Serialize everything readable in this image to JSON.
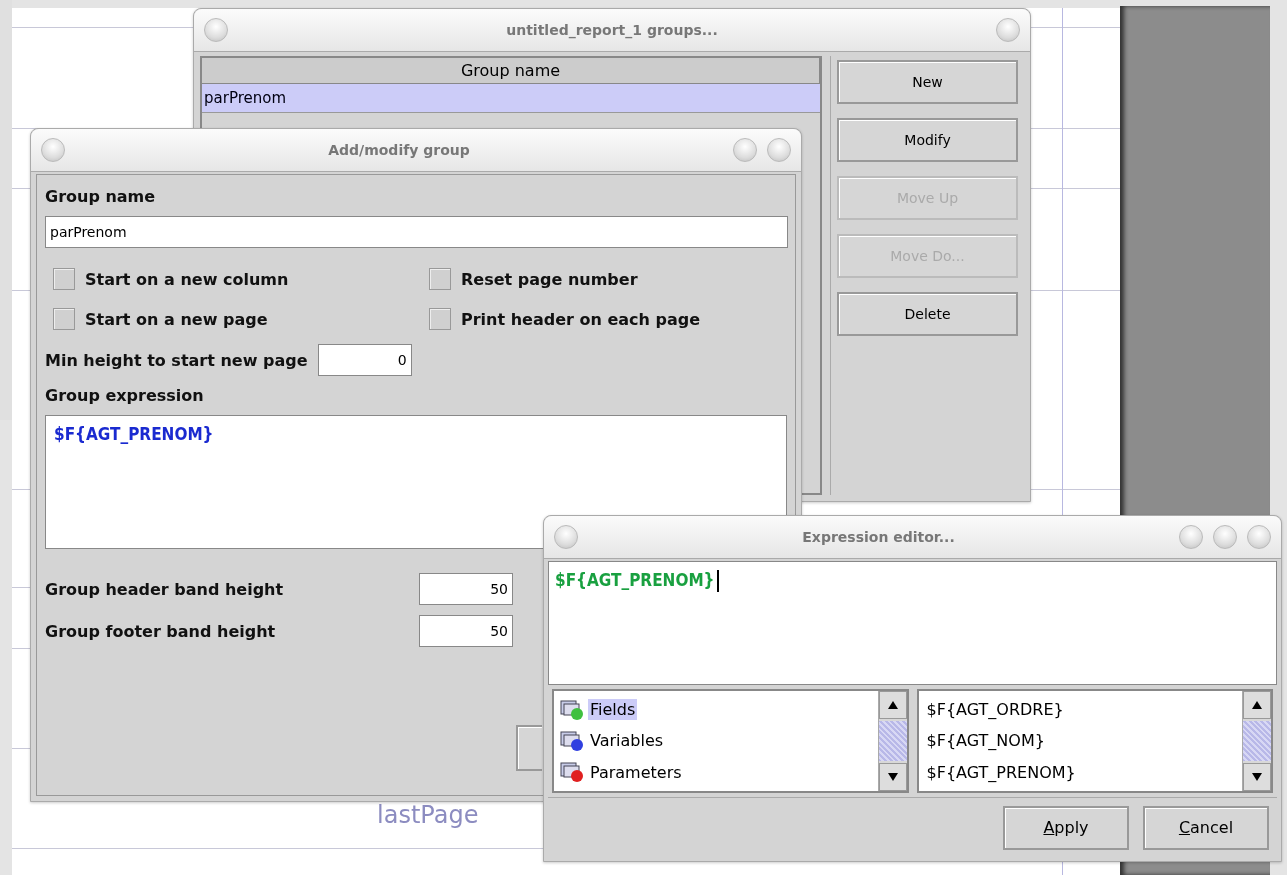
{
  "report_canvas": {
    "text": "lastPage"
  },
  "groups_window": {
    "title": "untitled_report_1 groups...",
    "table": {
      "columns": [
        "Group name"
      ],
      "rows": [
        {
          "cells": [
            "parPrenom"
          ],
          "selected": true
        }
      ]
    },
    "buttons": [
      {
        "label": "New",
        "disabled": false
      },
      {
        "label": "Modify",
        "disabled": false
      },
      {
        "label": "Move Up",
        "disabled": true
      },
      {
        "label": "Move Do...",
        "disabled": true
      },
      {
        "label": "Delete",
        "disabled": false
      }
    ]
  },
  "group_dialog": {
    "title": "Add/modify group",
    "group_name_label": "Group name",
    "group_name_value": "parPrenom",
    "options": [
      {
        "label": "Start on a new column",
        "checked": false
      },
      {
        "label": "Reset page number",
        "checked": false
      },
      {
        "label": "Start on a new page",
        "checked": false
      },
      {
        "label": "Print header on each page",
        "checked": false
      }
    ],
    "min_height_label": "Min height to start new page",
    "min_height_value": "0",
    "expression_label": "Group expression",
    "expression": "$F{AGT_PRENOM}",
    "header_height_label": "Group header band height",
    "header_height_value": "50",
    "footer_height_label": "Group footer band height",
    "footer_height_value": "50"
  },
  "expression_editor": {
    "title": "Expression editor...",
    "expression": "$F{AGT_PRENOM}",
    "focused": true,
    "categories": [
      {
        "label": "Fields",
        "selected": true,
        "color": "#40c040"
      },
      {
        "label": "Variables",
        "selected": false,
        "color": "#3040e0"
      },
      {
        "label": "Parameters",
        "selected": false,
        "color": "#e02020"
      }
    ],
    "items": [
      "$F{AGT_ORDRE}",
      "$F{AGT_NOM}",
      "$F{AGT_PRENOM}"
    ],
    "buttons": [
      {
        "label": "Apply"
      },
      {
        "label": "Cancel"
      }
    ]
  }
}
